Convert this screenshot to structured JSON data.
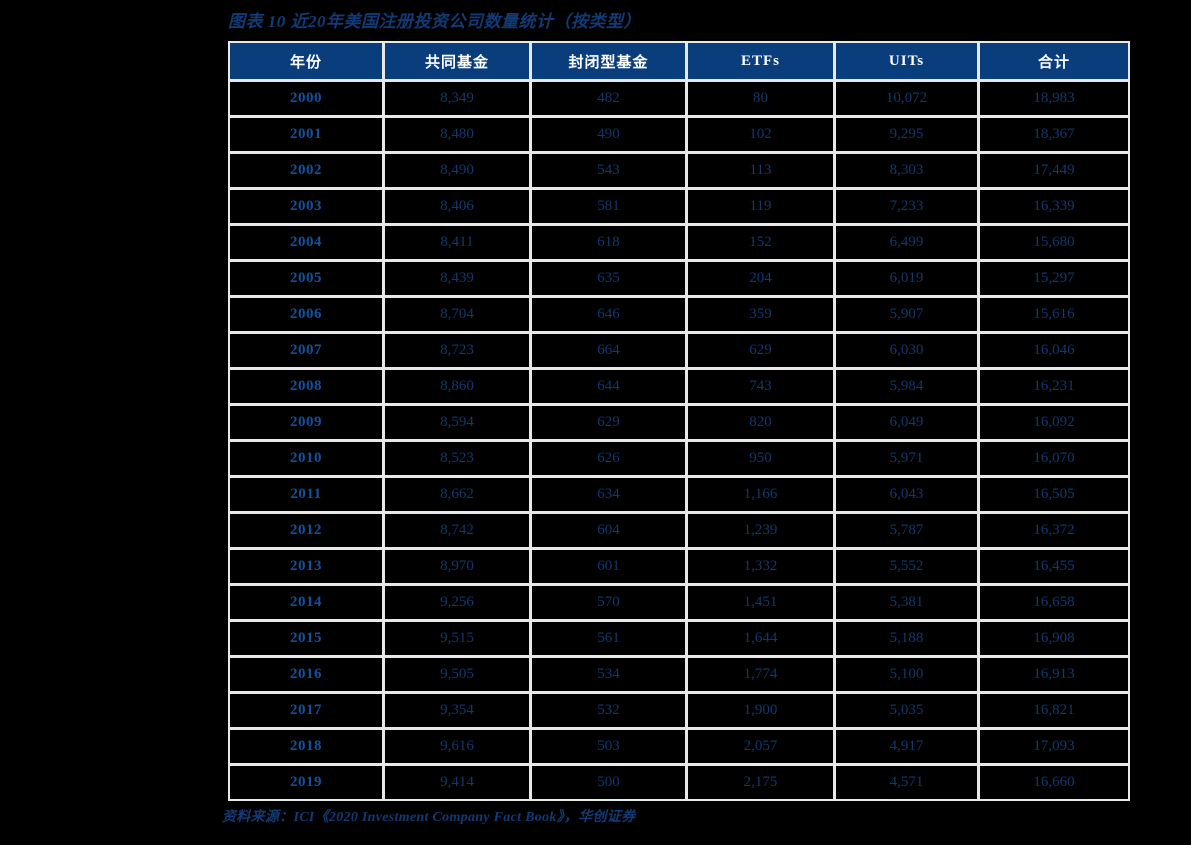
{
  "title": "图表 10   近20年美国注册投资公司数量统计（按类型）",
  "source_note": "资料来源：ICI《2020 Investment Company Fact Book》，华创证券",
  "colors": {
    "header_bg": "#0a3d7c",
    "header_text": "#ffffff",
    "grid_line": "#e8e8e6",
    "cell_text": "#12386f",
    "year_text": "#13509e",
    "title_text": "#123a75",
    "page_bg": "#000000"
  },
  "chart_data": {
    "type": "table",
    "title": "图表 10   近20年美国注册投资公司数量统计（按类型）",
    "columns": [
      "年份",
      "共同基金",
      "封闭型基金",
      "ETFs",
      "UITs",
      "合计"
    ],
    "rows": [
      [
        "2000",
        "8,349",
        "482",
        "80",
        "10,072",
        "18,983"
      ],
      [
        "2001",
        "8,480",
        "490",
        "102",
        "9,295",
        "18,367"
      ],
      [
        "2002",
        "8,490",
        "543",
        "113",
        "8,303",
        "17,449"
      ],
      [
        "2003",
        "8,406",
        "581",
        "119",
        "7,233",
        "16,339"
      ],
      [
        "2004",
        "8,411",
        "618",
        "152",
        "6,499",
        "15,680"
      ],
      [
        "2005",
        "8,439",
        "635",
        "204",
        "6,019",
        "15,297"
      ],
      [
        "2006",
        "8,704",
        "646",
        "359",
        "5,907",
        "15,616"
      ],
      [
        "2007",
        "8,723",
        "664",
        "629",
        "6,030",
        "16,046"
      ],
      [
        "2008",
        "8,860",
        "644",
        "743",
        "5,984",
        "16,231"
      ],
      [
        "2009",
        "8,594",
        "629",
        "820",
        "6,049",
        "16,092"
      ],
      [
        "2010",
        "8,523",
        "626",
        "950",
        "5,971",
        "16,070"
      ],
      [
        "2011",
        "8,662",
        "634",
        "1,166",
        "6,043",
        "16,505"
      ],
      [
        "2012",
        "8,742",
        "604",
        "1,239",
        "5,787",
        "16,372"
      ],
      [
        "2013",
        "8,970",
        "601",
        "1,332",
        "5,552",
        "16,455"
      ],
      [
        "2014",
        "9,256",
        "570",
        "1,451",
        "5,381",
        "16,658"
      ],
      [
        "2015",
        "9,515",
        "561",
        "1,644",
        "5,188",
        "16,908"
      ],
      [
        "2016",
        "9,505",
        "534",
        "1,774",
        "5,100",
        "16,913"
      ],
      [
        "2017",
        "9,354",
        "532",
        "1,900",
        "5,035",
        "16,821"
      ],
      [
        "2018",
        "9,616",
        "503",
        "2,057",
        "4,917",
        "17,093"
      ],
      [
        "2019",
        "9,414",
        "500",
        "2,175",
        "4,571",
        "16,660"
      ]
    ]
  }
}
